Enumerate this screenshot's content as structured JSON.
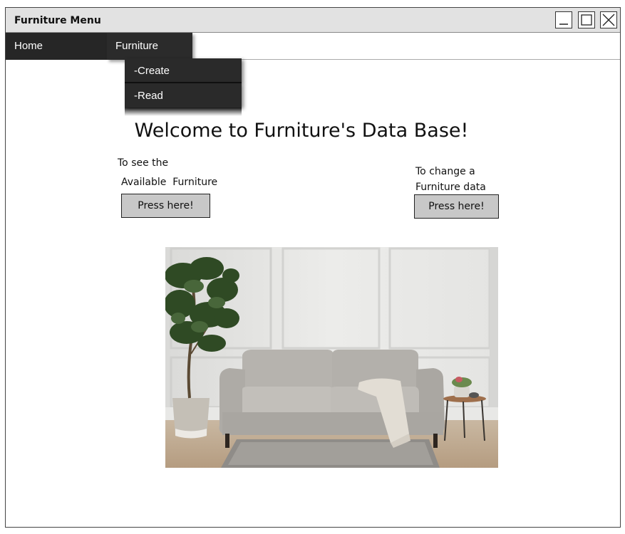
{
  "window": {
    "title": "Furniture Menu",
    "controls": {
      "minimize": "minimize-icon",
      "maximize": "maximize-icon",
      "close": "close-icon"
    }
  },
  "menubar": {
    "home_label": "Home",
    "furniture_label": "Furniture"
  },
  "dropdown": {
    "items": [
      {
        "label": "-Create"
      },
      {
        "label": "-Read"
      }
    ]
  },
  "main": {
    "welcome": "Welcome to Furniture's Data Base!",
    "left_block": {
      "line1": "To see the",
      "line2": "Available  Furniture",
      "button_label": "Press here!"
    },
    "right_block": {
      "line1": "To change a",
      "line2": "Furniture data",
      "button_label": "Press here!"
    },
    "image": {
      "subject": "living-room-sofa-photo"
    }
  },
  "colors": {
    "menu_dark": "#262626",
    "titlebar": "#e2e2e2",
    "button_fill": "#c8c8c8"
  }
}
